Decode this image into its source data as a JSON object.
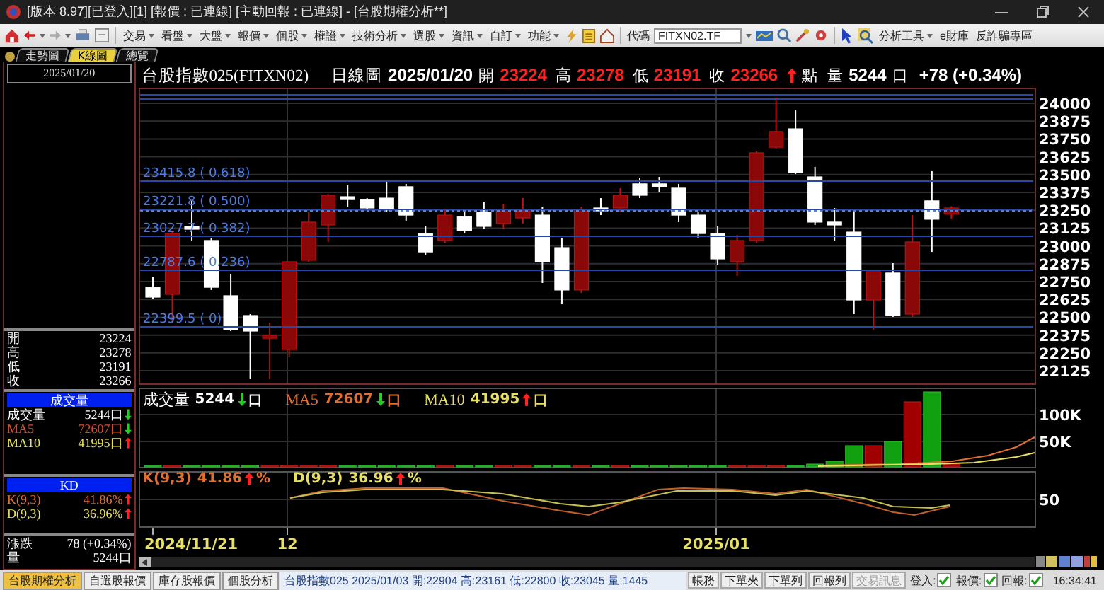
{
  "window": {
    "title": "[版本 8.97][已登入][1] [報價 : 已連線] [主動回報 : 已連線] - [台股期權分析**]"
  },
  "menu": [
    "交易",
    "看盤",
    "大盤",
    "報價",
    "個股",
    "權證",
    "技術分析",
    "選股",
    "資訊",
    "自訂",
    "功能"
  ],
  "toolbar": {
    "code_label": "代碼",
    "code_value": "FITXN02.TF",
    "links": [
      {
        "label": "分析工具",
        "dropdown": true
      },
      {
        "label": "e財庫",
        "dropdown": false
      },
      {
        "label": "反詐騙專區",
        "dropdown": false
      }
    ]
  },
  "view_tabs": [
    {
      "label": "走勢圖",
      "selected": false
    },
    {
      "label": "K線圖",
      "selected": true
    },
    {
      "label": "總覽",
      "selected": false
    }
  ],
  "left_panel": {
    "date": "2025/01/20",
    "quote": [
      {
        "label": "開",
        "value": "23224"
      },
      {
        "label": "高",
        "value": "23278"
      },
      {
        "label": "低",
        "value": "23191"
      },
      {
        "label": "收",
        "value": "23266"
      }
    ],
    "volume_title": "成交量",
    "volume_rows": [
      {
        "label": "成交量",
        "value": "5244口",
        "up": false,
        "color": "#ffffff"
      },
      {
        "label": "MA5",
        "value": "72607口",
        "up": false,
        "color": "#d05030"
      },
      {
        "label": "MA10",
        "value": "41995口",
        "up": true,
        "color": "#e8e060"
      }
    ],
    "kd_title": "KD",
    "kd_rows": [
      {
        "label": "K(9,3)",
        "value": "41.86%",
        "up": true,
        "color": "#e07030"
      },
      {
        "label": "D(9,3)",
        "value": "36.96%",
        "up": true,
        "color": "#e8e060"
      }
    ],
    "summary": [
      {
        "label": "漲跌",
        "value": "78 (+0.34%)"
      },
      {
        "label": "量",
        "value": "5244口"
      }
    ]
  },
  "chart": {
    "title": "台股指數025(FITXN02)",
    "period": "日線圖",
    "date": "2025/01/20",
    "ohlc": [
      {
        "label": "開",
        "value": "23224"
      },
      {
        "label": "高",
        "value": "23278"
      },
      {
        "label": "低",
        "value": "23191"
      },
      {
        "label": "收",
        "value": "23266"
      }
    ],
    "close_up": true,
    "unit": "點",
    "volume_label": "量",
    "volume": "5244",
    "volume_unit": "口",
    "change": "+78 (+0.34%)",
    "chart_data": {
      "type": "candlestick",
      "grid": true,
      "ohlc": [
        [
          22710,
          22780,
          22631,
          22641
        ],
        [
          22661,
          23107,
          22472,
          23087
        ],
        [
          23137,
          23316,
          23038,
          23117
        ],
        [
          23038,
          23058,
          22691,
          22710
        ],
        [
          22651,
          22800,
          22403,
          22413
        ],
        [
          22512,
          22522,
          22066,
          22403
        ],
        [
          22353,
          22462,
          22066,
          22373
        ],
        [
          22274,
          22889,
          22224,
          22889
        ],
        [
          22899,
          23236,
          22889,
          23167
        ],
        [
          23147,
          23365,
          23028,
          23355
        ],
        [
          23345,
          23425,
          23276,
          23325
        ],
        [
          23325,
          23335,
          23256,
          23266
        ],
        [
          23335,
          23454,
          23236,
          23256
        ],
        [
          23415,
          23435,
          23177,
          23216
        ],
        [
          23087,
          23137,
          22939,
          22958
        ],
        [
          23038,
          23256,
          23018,
          23216
        ],
        [
          23206,
          23236,
          23087,
          23107
        ],
        [
          23236,
          23306,
          23117,
          23137
        ],
        [
          23157,
          23296,
          23117,
          23256
        ],
        [
          23196,
          23335,
          23157,
          23246
        ],
        [
          23216,
          23276,
          22740,
          22889
        ],
        [
          22988,
          23058,
          22591,
          22691
        ],
        [
          22691,
          23276,
          22671,
          23256
        ],
        [
          23266,
          23335,
          23216,
          23246
        ],
        [
          23266,
          23405,
          23236,
          23355
        ],
        [
          23435,
          23474,
          23335,
          23355
        ],
        [
          23435,
          23484,
          23375,
          23415
        ],
        [
          23405,
          23435,
          23167,
          23216
        ],
        [
          23216,
          23236,
          23058,
          23087
        ],
        [
          23087,
          23137,
          22869,
          22909
        ],
        [
          22889,
          23077,
          22790,
          23038
        ],
        [
          23038,
          23663,
          23018,
          23653
        ],
        [
          23692,
          24040,
          23683,
          23802
        ],
        [
          23821,
          23950,
          23504,
          23514
        ],
        [
          23484,
          23554,
          23147,
          23167
        ],
        [
          23167,
          23266,
          23038,
          23147
        ],
        [
          23097,
          23246,
          22522,
          22621
        ],
        [
          22621,
          22820,
          22413,
          22820
        ],
        [
          22810,
          22879,
          22502,
          22512
        ],
        [
          22522,
          23216,
          22502,
          23028
        ],
        [
          23316,
          23524,
          22958,
          23187
        ],
        [
          23224,
          23278,
          23191,
          23266
        ]
      ],
      "ylim": [
        22026,
        24109
      ],
      "yticks": [
        24000,
        23875,
        23750,
        23625,
        23500,
        23375,
        23250,
        23125,
        23000,
        22875,
        22750,
        22625,
        22500,
        22375,
        22250,
        22125
      ]
    },
    "fib_levels": [
      "23415.8 ( 0.618)",
      "23221.8 ( 0.500)",
      "23027.7 ( 0.382)",
      "22787.6 ( 0.236)",
      "22399.5 ( 0)"
    ],
    "volume_legend": [
      {
        "label": "成交量",
        "value": "5244",
        "up": false,
        "unit": "口",
        "color": "#ffffff"
      },
      {
        "label": "MA5",
        "value": "72607",
        "up": false,
        "unit": "口",
        "color": "#e07030"
      },
      {
        "label": "MA10",
        "value": "41995",
        "up": true,
        "unit": "口",
        "color": "#e8e060"
      }
    ],
    "volume_axis": [
      "100K",
      "50K"
    ],
    "kd_legend": [
      {
        "label": "K(9,3)",
        "value": "41.86",
        "up": true,
        "unit": "%",
        "color": "#e07030"
      },
      {
        "label": "D(9,3)",
        "value": "36.96",
        "up": true,
        "unit": "%",
        "color": "#e8e060"
      }
    ],
    "kd_axis": [
      "50"
    ],
    "x_axis": [
      "2024/11/21",
      "12",
      "2025/01"
    ]
  },
  "bottom_bar": {
    "tabs": [
      {
        "label": "台股期權分析",
        "selected": true
      },
      {
        "label": "自選股報價",
        "selected": false
      },
      {
        "label": "庫存股報價",
        "selected": false
      },
      {
        "label": "個股分析",
        "selected": false
      }
    ],
    "status": "台股指數025 2025/01/03 開:22904 高:23161 低:22800 收:23045 量:1445",
    "buttons": [
      {
        "label": "帳務",
        "disabled": false
      },
      {
        "label": "下單夾",
        "disabled": false
      },
      {
        "label": "下單列",
        "disabled": false
      },
      {
        "label": "回報列",
        "disabled": false
      },
      {
        "label": "交易訊息",
        "disabled": true
      }
    ],
    "indicators": [
      {
        "label": "登入:",
        "checked": true
      },
      {
        "label": "報價:",
        "checked": true
      },
      {
        "label": "回報:",
        "checked": true
      }
    ],
    "time": "16:34:41"
  }
}
